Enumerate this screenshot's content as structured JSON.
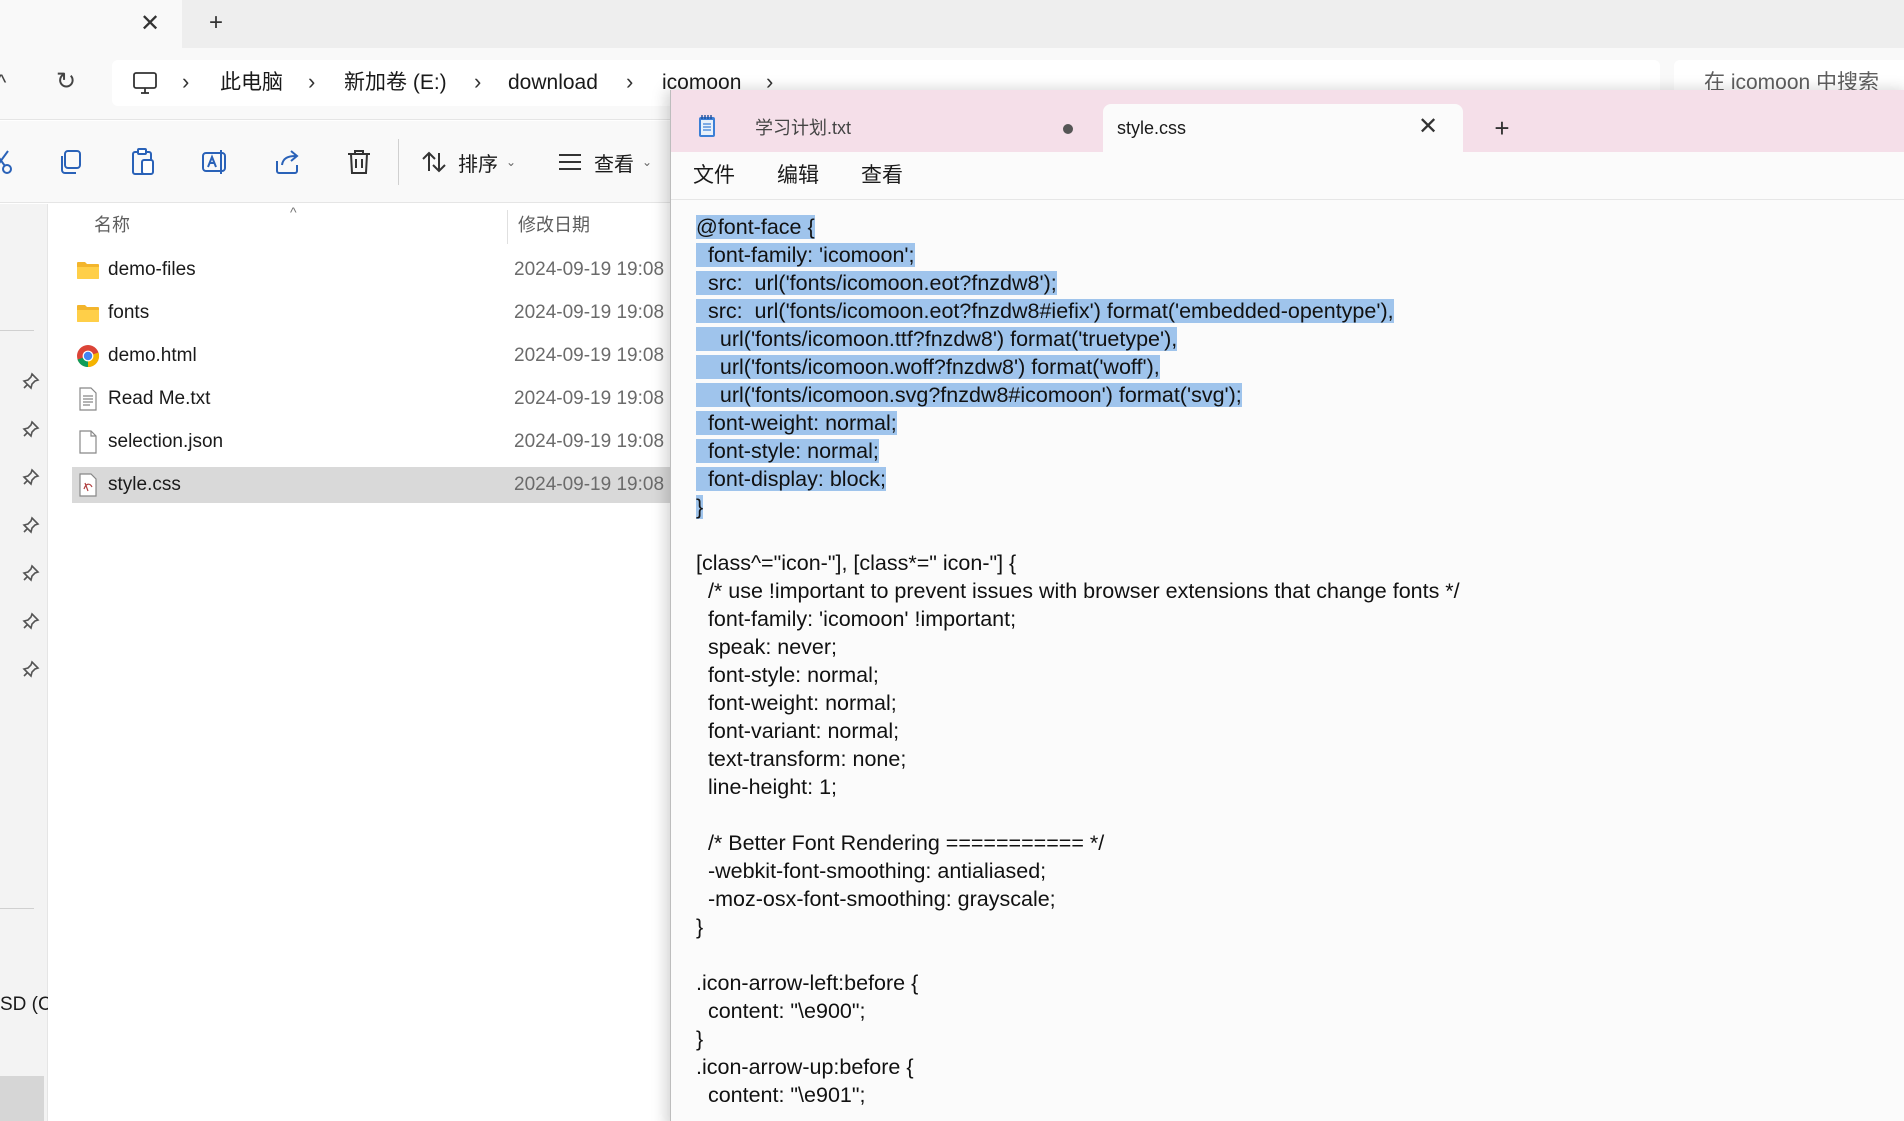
{
  "explorer": {
    "tab": {
      "close_glyph": "✕",
      "new_glyph": "+"
    },
    "nav": {
      "up_glyph": "^",
      "refresh_glyph": "↻",
      "sep_glyph": "›"
    },
    "breadcrumb": [
      "此电脑",
      "新加卷 (E:)",
      "download",
      "icomoon"
    ],
    "search": {
      "placeholder": "在 icomoon 中搜索"
    },
    "toolbar": {
      "sort_label": "排序",
      "view_label": "查看",
      "icons": [
        "cut-icon",
        "copy-icon",
        "paste-icon",
        "rename-icon",
        "share-icon",
        "delete-icon"
      ]
    },
    "columns": {
      "name": "名称",
      "modified": "修改日期",
      "sort_caret": "^"
    },
    "files": [
      {
        "name": "demo-files",
        "date": "2024-09-19 19:08",
        "icon": "folder-icon"
      },
      {
        "name": "fonts",
        "date": "2024-09-19 19:08",
        "icon": "folder-icon"
      },
      {
        "name": "demo.html",
        "date": "2024-09-19 19:08",
        "icon": "chrome-icon"
      },
      {
        "name": "Read Me.txt",
        "date": "2024-09-19 19:08",
        "icon": "text-file-icon"
      },
      {
        "name": "selection.json",
        "date": "2024-09-19 19:08",
        "icon": "file-icon"
      },
      {
        "name": "style.css",
        "date": "2024-09-19 19:08",
        "icon": "css-file-icon",
        "selected": true
      }
    ],
    "left_pane": {
      "drive_label": "SD (C"
    }
  },
  "notepad": {
    "tabs": [
      {
        "title": "学习计划.txt",
        "unsaved": true,
        "active": false
      },
      {
        "title": "style.css",
        "unsaved": false,
        "active": true
      }
    ],
    "tab_close_glyph": "✕",
    "new_tab_glyph": "+",
    "menu": [
      "文件",
      "编辑",
      "查看"
    ],
    "highlight_color": "#9fc4ec",
    "code_lines": [
      "@font-face {",
      "  font-family: 'icomoon';",
      "  src:  url('fonts/icomoon.eot?fnzdw8');",
      "  src:  url('fonts/icomoon.eot?fnzdw8#iefix') format('embedded-opentype'),",
      "    url('fonts/icomoon.ttf?fnzdw8') format('truetype'),",
      "    url('fonts/icomoon.woff?fnzdw8') format('woff'),",
      "    url('fonts/icomoon.svg?fnzdw8#icomoon') format('svg');",
      "  font-weight: normal;",
      "  font-style: normal;",
      "  font-display: block;",
      "}",
      "",
      "[class^=\"icon-\"], [class*=\" icon-\"] {",
      "  /* use !important to prevent issues with browser extensions that change fonts */",
      "  font-family: 'icomoon' !important;",
      "  speak: never;",
      "  font-style: normal;",
      "  font-weight: normal;",
      "  font-variant: normal;",
      "  text-transform: none;",
      "  line-height: 1;",
      "",
      "  /* Better Font Rendering =========== */",
      "  -webkit-font-smoothing: antialiased;",
      "  -moz-osx-font-smoothing: grayscale;",
      "}",
      "",
      ".icon-arrow-left:before {",
      "  content: \"\\e900\";",
      "}",
      ".icon-arrow-up:before {",
      "  content: \"\\e901\";"
    ],
    "selected_line_count": 11
  }
}
